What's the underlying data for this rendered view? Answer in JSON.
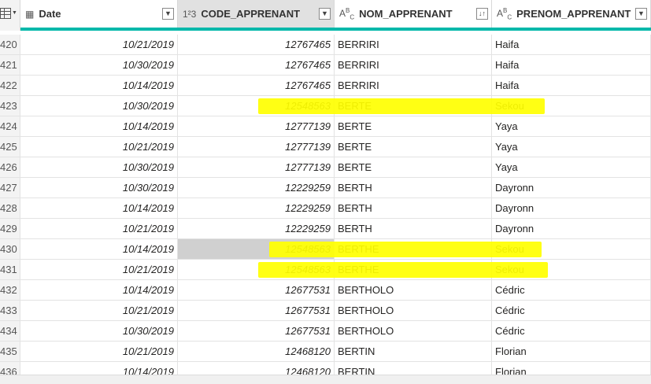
{
  "columns": [
    {
      "type_icon": "▦",
      "label": "Date",
      "dropdown": "▼"
    },
    {
      "type_icon": "1²3",
      "label": "CODE_APPRENANT",
      "dropdown": "▼"
    },
    {
      "type_icon": "A^B_C",
      "label": "NOM_APPRENANT",
      "dropdown": "↓↑"
    },
    {
      "type_icon": "A^B_C",
      "label": "PRENOM_APPRENANT",
      "dropdown": "▼"
    }
  ],
  "column_icons": {
    "Date": "calendar-table-icon",
    "CODE_APPRENANT": "whole-number-icon",
    "NOM_APPRENANT": "text-type-icon",
    "PRENOM_APPRENANT": "text-type-icon"
  },
  "rows": [
    {
      "n": "420",
      "date": "10/21/2019",
      "code": "12767465",
      "nom": "BERRIRI",
      "prenom": "Haifa"
    },
    {
      "n": "421",
      "date": "10/30/2019",
      "code": "12767465",
      "nom": "BERRIRI",
      "prenom": "Haifa"
    },
    {
      "n": "422",
      "date": "10/14/2019",
      "code": "12767465",
      "nom": "BERRIRI",
      "prenom": "Haifa"
    },
    {
      "n": "423",
      "date": "10/30/2019",
      "code": "12548563",
      "nom": "BERTE",
      "prenom": "Sekou"
    },
    {
      "n": "424",
      "date": "10/14/2019",
      "code": "12777139",
      "nom": "BERTE",
      "prenom": "Yaya"
    },
    {
      "n": "425",
      "date": "10/21/2019",
      "code": "12777139",
      "nom": "BERTE",
      "prenom": "Yaya"
    },
    {
      "n": "426",
      "date": "10/30/2019",
      "code": "12777139",
      "nom": "BERTE",
      "prenom": "Yaya"
    },
    {
      "n": "427",
      "date": "10/30/2019",
      "code": "12229259",
      "nom": "BERTH",
      "prenom": "Dayronn"
    },
    {
      "n": "428",
      "date": "10/14/2019",
      "code": "12229259",
      "nom": "BERTH",
      "prenom": "Dayronn"
    },
    {
      "n": "429",
      "date": "10/21/2019",
      "code": "12229259",
      "nom": "BERTH",
      "prenom": "Dayronn"
    },
    {
      "n": "430",
      "date": "10/14/2019",
      "code": "12548563",
      "nom": "BERTHE",
      "prenom": "Sekou"
    },
    {
      "n": "431",
      "date": "10/21/2019",
      "code": "12548563",
      "nom": "BERTHE",
      "prenom": "Sekou"
    },
    {
      "n": "432",
      "date": "10/14/2019",
      "code": "12677531",
      "nom": "BERTHOLO",
      "prenom": "Cédric"
    },
    {
      "n": "433",
      "date": "10/21/2019",
      "code": "12677531",
      "nom": "BERTHOLO",
      "prenom": "Cédric"
    },
    {
      "n": "434",
      "date": "10/30/2019",
      "code": "12677531",
      "nom": "BERTHOLO",
      "prenom": "Cédric"
    },
    {
      "n": "435",
      "date": "10/21/2019",
      "code": "12468120",
      "nom": "BERTIN",
      "prenom": "Florian"
    },
    {
      "n": "436",
      "date": "10/14/2019",
      "code": "12468120",
      "nom": "BERTIN",
      "prenom": "Florian"
    }
  ],
  "highlighted_rows": [
    "423",
    "430",
    "431"
  ],
  "selected_cell": {
    "row": "430",
    "column": "CODE_APPRENANT"
  },
  "colors": {
    "accent": "#01b8aa",
    "highlight": "#ffff00",
    "selected_header": "#e1e1e1",
    "selected_cell": "#d0d0d0"
  }
}
